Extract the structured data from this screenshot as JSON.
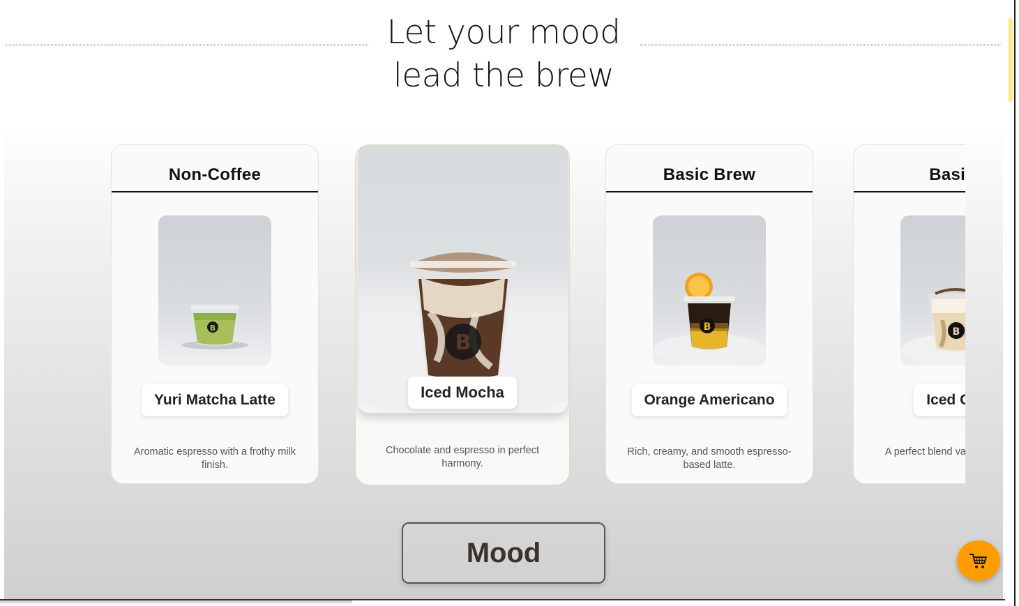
{
  "heading": {
    "line1": "Let your mood",
    "line2": "lead the brew"
  },
  "carousel": {
    "cards": [
      {
        "category": "",
        "name": "",
        "description": ""
      },
      {
        "category": "Non-Coffee",
        "name": "Yuri Matcha Latte",
        "description": "Aromatic espresso with a frothy milk finish."
      },
      {
        "category": "",
        "name": "Iced Mocha",
        "description": "Chocolate and espresso in perfect harmony.",
        "featured": true
      },
      {
        "category": "Basic Brew",
        "name": "Orange Americano",
        "description": "Rich, creamy, and smooth espresso-based latte."
      },
      {
        "category": "Basic I",
        "name": "Iced Cap",
        "description": "A perfect blend vanilla, and cara"
      }
    ]
  },
  "mood_button": {
    "label": "Mood"
  },
  "cart": {
    "icon": "cart-icon",
    "color": "#ff9d00"
  },
  "colors": {
    "accent": "#ff9d00",
    "scroll_thumb": "#ffe98a",
    "mood_text": "#3a3327"
  }
}
